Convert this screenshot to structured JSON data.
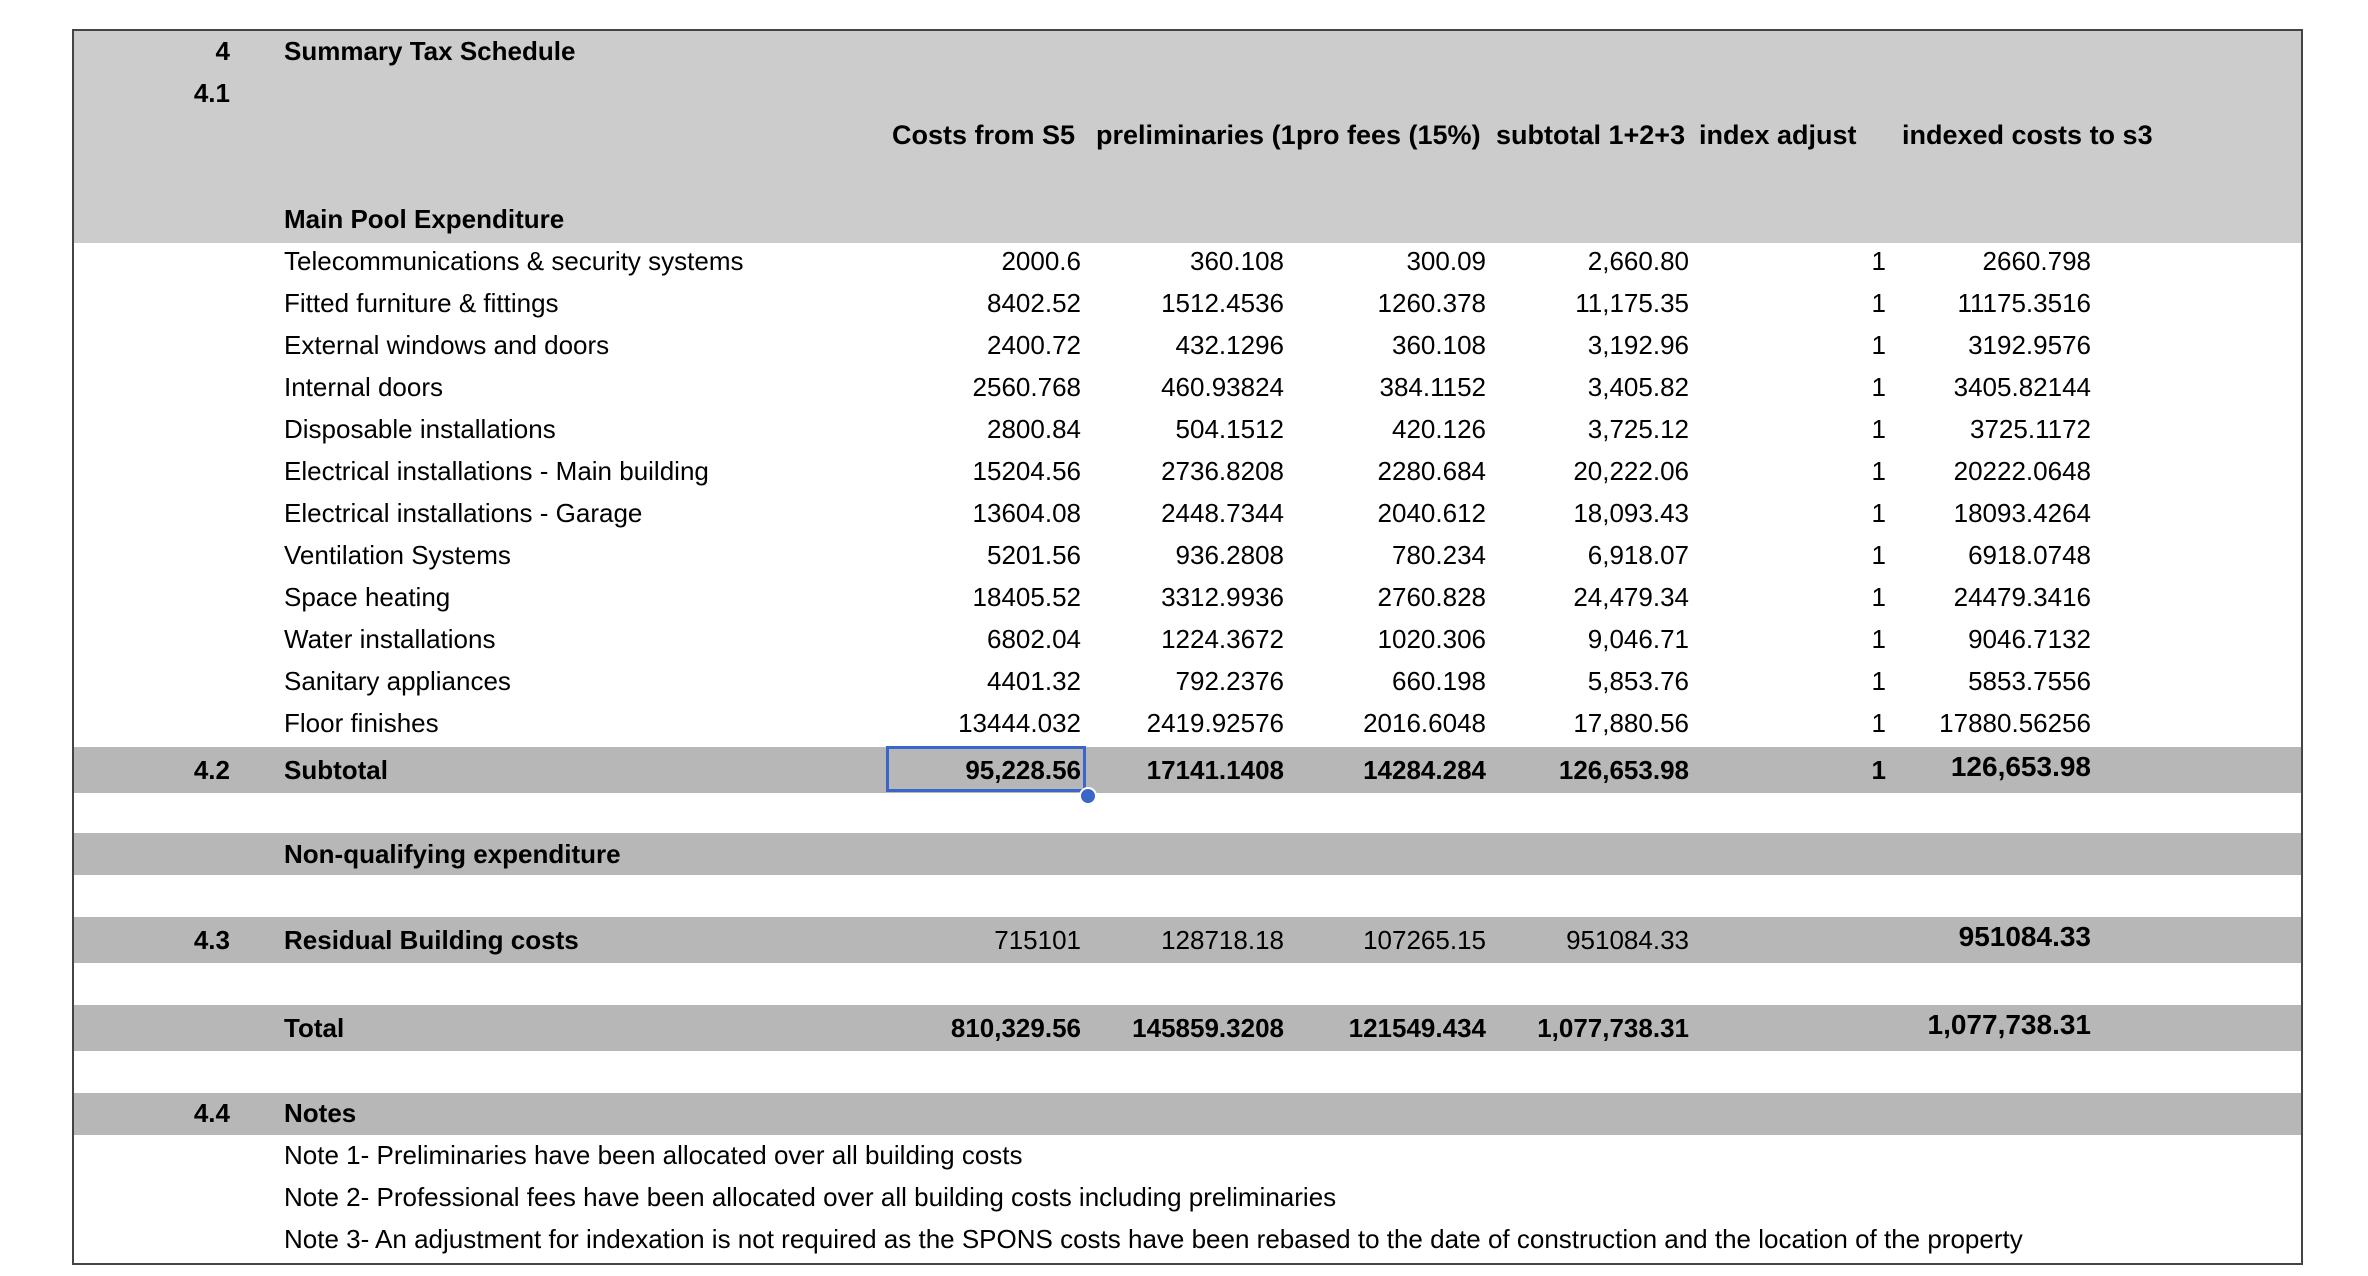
{
  "sheet": {
    "section_num": "4",
    "title": "Summary Tax Schedule",
    "sub_num": "4.1",
    "columns": [
      "Costs from S5",
      "preliminaries (1",
      "pro fees (15%)",
      "subtotal 1+2+3",
      "index adjust",
      "indexed costs to s3"
    ],
    "main_pool_label": "Main Pool Expenditure",
    "rows": [
      {
        "label": "Telecommunications & security systems",
        "v": [
          "2000.6",
          "360.108",
          "300.09",
          "2,660.80",
          "1",
          "2660.798"
        ]
      },
      {
        "label": "Fitted furniture & fittings",
        "v": [
          "8402.52",
          "1512.4536",
          "1260.378",
          "11,175.35",
          "1",
          "11175.3516"
        ]
      },
      {
        "label": "External windows and doors",
        "v": [
          "2400.72",
          "432.1296",
          "360.108",
          "3,192.96",
          "1",
          "3192.9576"
        ]
      },
      {
        "label": "Internal doors",
        "v": [
          "2560.768",
          "460.93824",
          "384.1152",
          "3,405.82",
          "1",
          "3405.82144"
        ]
      },
      {
        "label": "Disposable installations",
        "v": [
          "2800.84",
          "504.1512",
          "420.126",
          "3,725.12",
          "1",
          "3725.1172"
        ]
      },
      {
        "label": "Electrical installations - Main building",
        "v": [
          "15204.56",
          "2736.8208",
          "2280.684",
          "20,222.06",
          "1",
          "20222.0648"
        ]
      },
      {
        "label": "Electrical installations  - Garage",
        "v": [
          "13604.08",
          "2448.7344",
          "2040.612",
          "18,093.43",
          "1",
          "18093.4264"
        ]
      },
      {
        "label": "Ventilation Systems",
        "v": [
          "5201.56",
          "936.2808",
          "780.234",
          "6,918.07",
          "1",
          "6918.0748"
        ]
      },
      {
        "label": "Space heating",
        "v": [
          "18405.52",
          "3312.9936",
          "2760.828",
          "24,479.34",
          "1",
          "24479.3416"
        ]
      },
      {
        "label": "Water installations",
        "v": [
          "6802.04",
          "1224.3672",
          "1020.306",
          "9,046.71",
          "1",
          "9046.7132"
        ]
      },
      {
        "label": "Sanitary appliances",
        "v": [
          "4401.32",
          "792.2376",
          "660.198",
          "5,853.76",
          "1",
          "5853.7556"
        ]
      },
      {
        "label": "Floor finishes",
        "v": [
          "13444.032",
          "2419.92576",
          "2016.6048",
          "17,880.56",
          "1",
          "17880.56256"
        ]
      }
    ],
    "subtotal": {
      "num": "4.2",
      "label": "Subtotal",
      "v": [
        "95,228.56",
        "17141.1408",
        "14284.284",
        "126,653.98",
        "1",
        "126,653.98"
      ]
    },
    "nonqual_label": "Non-qualifying expenditure",
    "residual": {
      "num": "4.3",
      "label": "Residual Building costs",
      "v": [
        "715101",
        "128718.18",
        "107265.15",
        "951084.33",
        "",
        "951084.33"
      ]
    },
    "total": {
      "label": "Total",
      "v": [
        "810,329.56",
        "145859.3208",
        "121549.434",
        "1,077,738.31",
        "",
        "1,077,738.31"
      ]
    },
    "notes": {
      "num": "4.4",
      "label": "Notes",
      "items": [
        "Note 1- Preliminaries have been allocated over all building costs",
        "Note 2- Professional fees have been allocated over all building costs including preliminaries",
        "Note 3- An adjustment for indexation is not required as the SPONS costs have been rebased to the date of construction and the location of the property"
      ]
    }
  }
}
